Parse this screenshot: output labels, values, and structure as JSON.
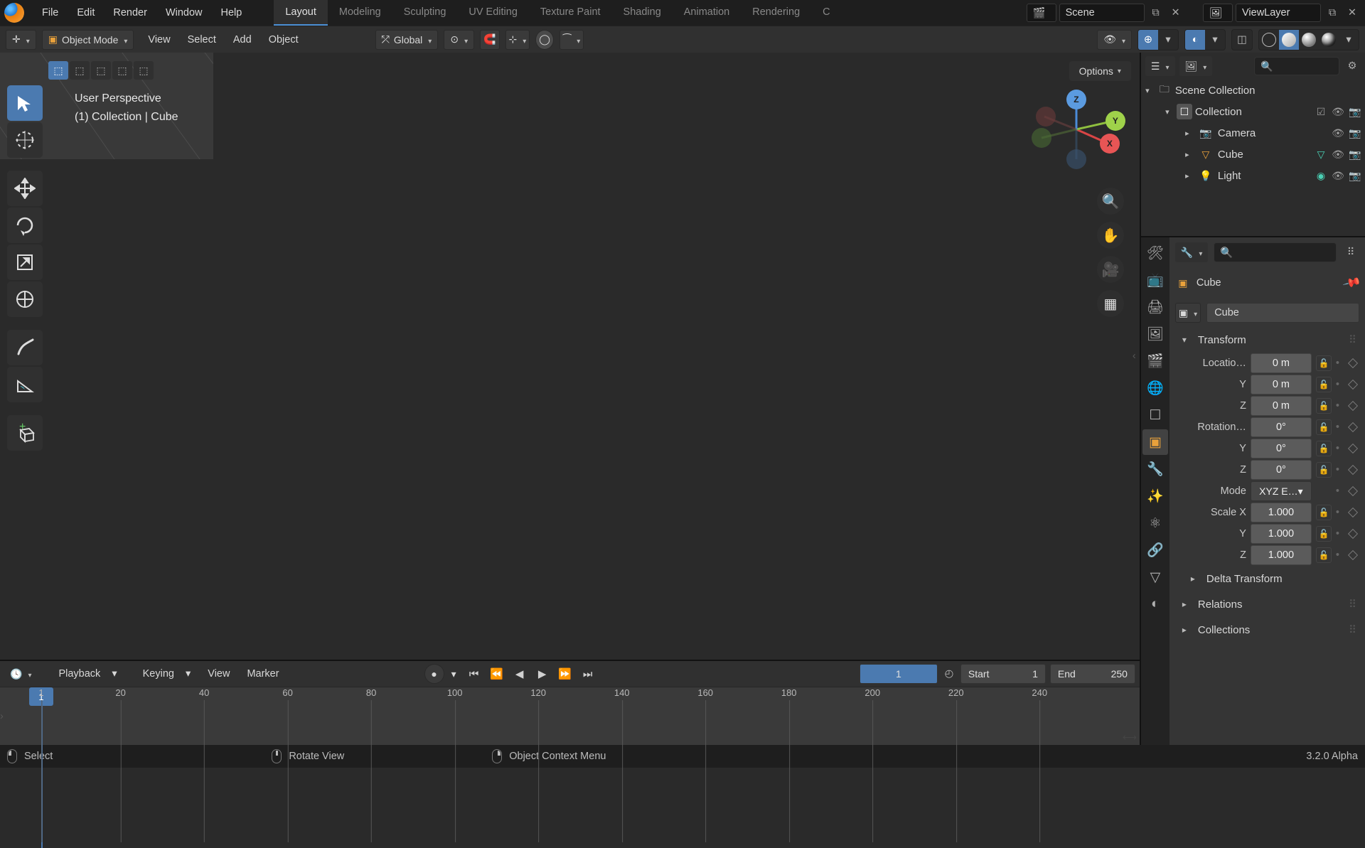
{
  "top_menu": [
    "File",
    "Edit",
    "Render",
    "Window",
    "Help"
  ],
  "workspaces": [
    "Layout",
    "Modeling",
    "Sculpting",
    "UV Editing",
    "Texture Paint",
    "Shading",
    "Animation",
    "Rendering",
    "C"
  ],
  "workspace_active": "Layout",
  "scene_name": "Scene",
  "viewlayer_name": "ViewLayer",
  "header2": {
    "mode": "Object Mode",
    "menu": [
      "View",
      "Select",
      "Add",
      "Object"
    ],
    "orientation": "Global",
    "options_label": "Options"
  },
  "viewport": {
    "line1": "User Perspective",
    "line2": "(1) Collection | Cube",
    "axes": {
      "x": "X",
      "y": "Y",
      "z": "Z"
    }
  },
  "outliner": {
    "root": "Scene Collection",
    "collection": "Collection",
    "items": [
      {
        "name": "Camera",
        "icon": "camera",
        "color": "#e9a13b"
      },
      {
        "name": "Cube",
        "icon": "mesh",
        "color": "#e9a13b"
      },
      {
        "name": "Light",
        "icon": "light",
        "color": "#e9a13b"
      }
    ]
  },
  "properties": {
    "object_name": "Cube",
    "datablock_name": "Cube",
    "transform_label": "Transform",
    "loc_label": "Locatio…",
    "rot_label": "Rotation…",
    "scale_label": "Scale X",
    "mode_label": "Mode",
    "mode_value": "XYZ E…",
    "loc": {
      "x": "0 m",
      "y": "0 m",
      "z": "0 m"
    },
    "rot": {
      "x": "0°",
      "y": "0°",
      "z": "0°"
    },
    "scale": {
      "x": "1.000",
      "y": "1.000",
      "z": "1.000"
    },
    "axis": {
      "y": "Y",
      "z": "Z"
    },
    "delta_label": "Delta Transform",
    "relations_label": "Relations",
    "collections_label": "Collections"
  },
  "timeline": {
    "menus": [
      "Playback",
      "Keying",
      "View",
      "Marker"
    ],
    "current": "1",
    "start_label": "Start",
    "start": "1",
    "end_label": "End",
    "end": "250",
    "ticks": [
      "1",
      "20",
      "40",
      "60",
      "80",
      "100",
      "120",
      "140",
      "160",
      "180",
      "200",
      "220",
      "240"
    ]
  },
  "status": {
    "select": "Select",
    "rotate": "Rotate View",
    "context": "Object Context Menu",
    "version": "3.2.0 Alpha"
  }
}
